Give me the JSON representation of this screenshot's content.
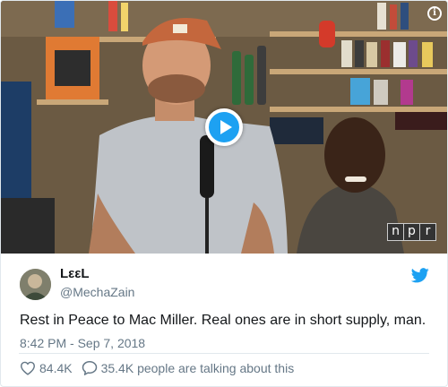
{
  "video": {
    "info_icon": "info-icon",
    "play_icon": "play-icon",
    "logo_letters": [
      "n",
      "p",
      "r"
    ]
  },
  "author": {
    "display_name": "LεεL",
    "handle": "@MechaZain"
  },
  "tweet": {
    "text": "Rest in Peace to Mac Miller. Real ones are in short supply, man.",
    "timestamp": "8:42 PM - Sep 7, 2018"
  },
  "actions": {
    "likes": "84.4K",
    "talking": "35.4K people are talking about this"
  },
  "colors": {
    "twitter_blue": "#1da1f2",
    "text_primary": "#14171a",
    "text_secondary": "#657786",
    "border": "#e1e8ed"
  }
}
